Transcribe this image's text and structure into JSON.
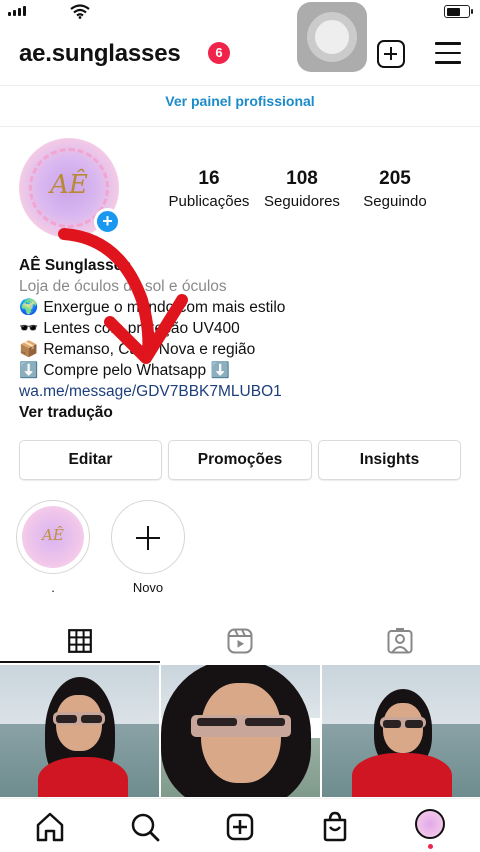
{
  "header": {
    "username": "ae.sunglasses",
    "notification_count": "6"
  },
  "professional_link": "Ver painel profissional",
  "profile": {
    "avatar_logo": "AÊ",
    "stats": [
      {
        "value": "16",
        "label": "Publicações"
      },
      {
        "value": "108",
        "label": "Seguidores"
      },
      {
        "value": "205",
        "label": "Seguindo"
      }
    ],
    "name": "AÊ Sunglasses",
    "category": "Loja de óculos de sol e óculos",
    "bio_lines": [
      {
        "emoji": "🌍",
        "text": "Enxergue o mundo com mais estilo"
      },
      {
        "emoji": "🕶️",
        "text": "Lentes com proteção UV400"
      },
      {
        "emoji": "📦",
        "text": "Remanso, Casa Nova e região"
      },
      {
        "emoji": "⬇️",
        "text": "Compre pelo Whatsapp",
        "emoji_after": "⬇️"
      }
    ],
    "link": "wa.me/message/GDV7BBK7MLUBO1",
    "translate": "Ver tradução"
  },
  "actions": {
    "edit": "Editar",
    "promotions": "Promoções",
    "insights": "Insights"
  },
  "highlights": [
    {
      "label": ".",
      "cover": "AÊ"
    },
    {
      "label": "Novo"
    }
  ],
  "colors": {
    "accent_blue": "#1a98f0",
    "link_blue": "#1d8bc9",
    "badge_red": "#f0244b",
    "annotation_arrow": "#e0141c"
  },
  "tabs": [
    "grid-icon",
    "reels-icon",
    "tagged-icon"
  ],
  "bottom_nav": [
    "home-icon",
    "search-icon",
    "create-icon",
    "shop-icon",
    "profile-avatar"
  ]
}
